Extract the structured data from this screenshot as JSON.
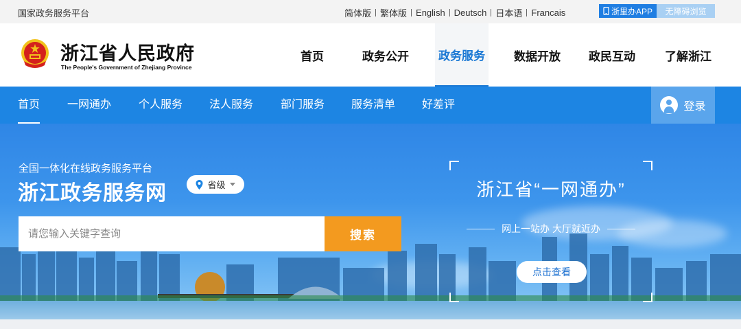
{
  "topbar": {
    "platform": "国家政务服务平台",
    "languages": [
      "简体版",
      "繁体版",
      "English",
      "Deutsch",
      "日本语",
      "Francais"
    ],
    "app_button": "浙里办APP",
    "accessibility_button": "无障碍浏览"
  },
  "header": {
    "title": "浙江省人民政府",
    "subtitle": "The People's Government of Zhejiang Province",
    "nav": [
      {
        "label": "首页",
        "active": false
      },
      {
        "label": "政务公开",
        "active": false
      },
      {
        "label": "政务服务",
        "active": true
      },
      {
        "label": "数据开放",
        "active": false
      },
      {
        "label": "政民互动",
        "active": false
      },
      {
        "label": "了解浙江",
        "active": false
      }
    ]
  },
  "subnav": {
    "items": [
      {
        "label": "首页",
        "active": true
      },
      {
        "label": "一网通办",
        "active": false
      },
      {
        "label": "个人服务",
        "active": false
      },
      {
        "label": "法人服务",
        "active": false
      },
      {
        "label": "部门服务",
        "active": false
      },
      {
        "label": "服务清单",
        "active": false
      },
      {
        "label": "好差评",
        "active": false
      }
    ],
    "login": "登录"
  },
  "hero": {
    "kicker": "全国一体化在线政务服务平台",
    "brand": "浙江政务服务网",
    "level_select": "省级",
    "search_placeholder": "请您输入关键字查询",
    "search_button": "搜索",
    "promo": {
      "title": "浙江省“一网通办”",
      "subtitle": "网上一站办 大厅就近办",
      "button": "点击查看"
    }
  },
  "colors": {
    "accent": "#1d85e3",
    "search_button": "#f39a1f",
    "emblem_red": "#d4201d",
    "emblem_gold": "#f2c21b"
  },
  "icons": [
    "national-emblem-icon",
    "phone-icon",
    "user-avatar-icon",
    "location-pin-icon",
    "chevron-down-icon"
  ]
}
